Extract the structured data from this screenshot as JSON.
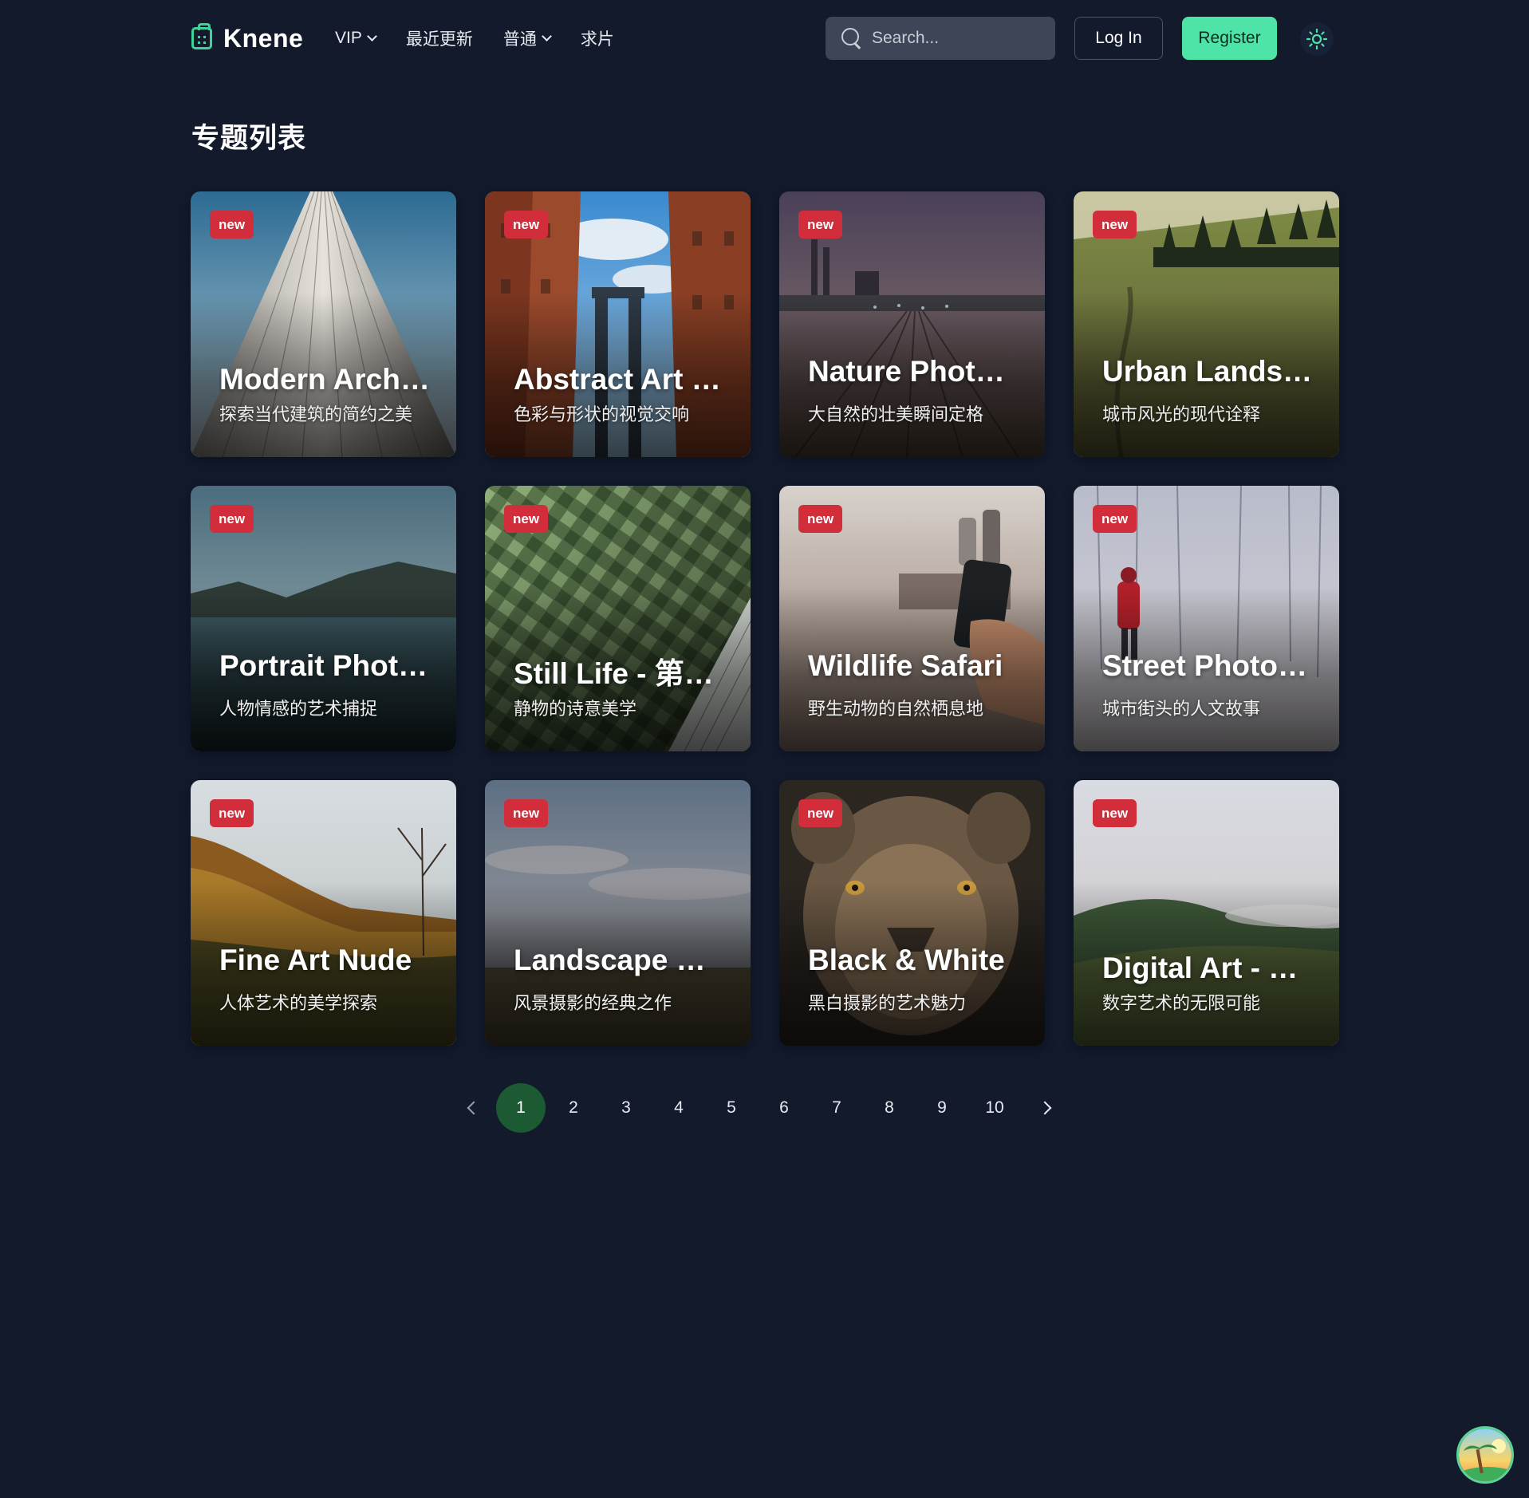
{
  "header": {
    "brand": "Knene",
    "nav": [
      {
        "label": "VIP",
        "has_dropdown": true
      },
      {
        "label": "最近更新",
        "has_dropdown": false
      },
      {
        "label": "普通",
        "has_dropdown": true
      },
      {
        "label": "求片",
        "has_dropdown": false
      }
    ],
    "search_placeholder": "Search...",
    "login_label": "Log In",
    "register_label": "Register",
    "theme_icon": "sun-icon"
  },
  "page_title": "专题列表",
  "badge_label": "new",
  "cards": [
    {
      "title": "Modern Architecture - 现代建筑",
      "subtitle": "探索当代建筑的简约之美",
      "image": "skyscraper-photo"
    },
    {
      "title": "Abstract Art - 抽象艺术",
      "subtitle": "色彩与形状的视觉交响",
      "image": "bridge-city-photo"
    },
    {
      "title": "Nature Photography",
      "subtitle": "大自然的壮美瞬间定格",
      "image": "rail-yard-dusk-photo"
    },
    {
      "title": "Urban Landscapes",
      "subtitle": "城市风光的现代诠释",
      "image": "meadow-forest-photo"
    },
    {
      "title": "Portrait Photography",
      "subtitle": "人物情感的艺术捕捉",
      "image": "lake-mountain-photo"
    },
    {
      "title": "Still Life - 第一视角",
      "subtitle": "静物的诗意美学",
      "image": "green-facade-photo"
    },
    {
      "title": "Wildlife Safari",
      "subtitle": "野生动物的自然栖息地",
      "image": "hand-phone-photo"
    },
    {
      "title": "Street Photography",
      "subtitle": "城市街头的人文故事",
      "image": "snow-forest-photo"
    },
    {
      "title": "Fine Art Nude",
      "subtitle": "人体艺术的美学探索",
      "image": "autumn-hills-photo"
    },
    {
      "title": "Landscape Masters",
      "subtitle": "风景摄影的经典之作",
      "image": "cloudy-field-photo"
    },
    {
      "title": "Black & White",
      "subtitle": "黑白摄影的艺术魅力",
      "image": "lioness-photo"
    },
    {
      "title": "Digital Art - 数字艺术",
      "subtitle": "数字艺术的无限可能",
      "image": "misty-hills-photo"
    }
  ],
  "pagination": {
    "pages": [
      "1",
      "2",
      "3",
      "4",
      "5",
      "6",
      "7",
      "8",
      "9",
      "10"
    ],
    "current": "1"
  },
  "colors": {
    "background": "#121a2c",
    "accent": "#4ee3a7",
    "badge": "#d22d3b",
    "active_page": "#1c5a34"
  }
}
